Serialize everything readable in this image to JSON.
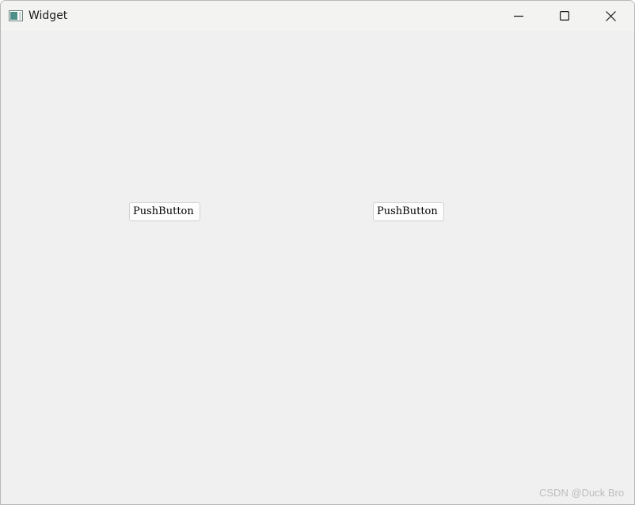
{
  "window": {
    "title": "Widget",
    "icon": "qt-app-window-icon",
    "controls": {
      "minimize_icon": "minimize-icon",
      "maximize_icon": "maximize-icon",
      "close_icon": "close-icon"
    }
  },
  "buttons": [
    {
      "label": "PushButton"
    },
    {
      "label": "PushButton"
    }
  ],
  "watermark": {
    "text": "CSDN @Duck Bro"
  },
  "colors": {
    "titlebar_bg": "#f3f3f2",
    "client_bg": "#f0f0f0",
    "button_bg": "#fdfdfd",
    "button_border": "#d0d0d0"
  }
}
